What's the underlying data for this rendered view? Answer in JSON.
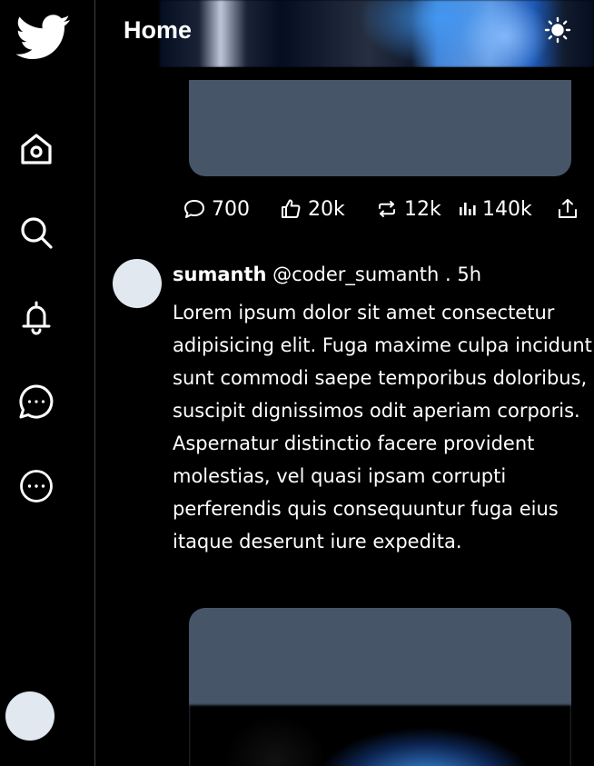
{
  "header": {
    "title": "Home"
  },
  "icons": {
    "logo": "twitter-bird-icon",
    "nav": [
      "home-icon",
      "search-icon",
      "bell-icon",
      "messages-icon",
      "more-icon"
    ],
    "theme": "sun-icon"
  },
  "stats": {
    "comments": "700",
    "likes": "20k",
    "retweets": "12k",
    "views": "140k"
  },
  "tweet": {
    "name": "sumanth",
    "handle": "@coder_sumanth",
    "time": ". 5h",
    "text": "Lorem ipsum dolor sit amet consectetur adipisicing elit. Fuga maxime culpa incidunt sunt commodi saepe temporibus doloribus, suscipit dignissimos odit aperiam corporis. Aspernatur distinctio facere provident molestias, vel quasi ipsam corrupti perferendis quis consequuntur fuga eius itaque deserunt iure expedita."
  },
  "colors": {
    "background": "#000000",
    "card": "#475569",
    "avatar": "#e2e8f0",
    "divider": "#3a3f45"
  }
}
